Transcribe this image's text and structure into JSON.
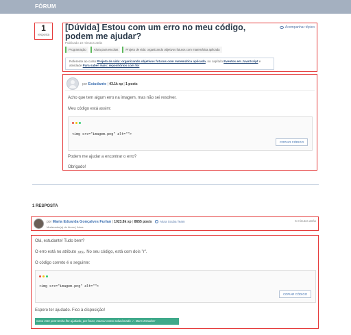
{
  "nav": {
    "title": "FÓRUM"
  },
  "topic": {
    "answer_count": "1",
    "answer_count_label": "resposta",
    "title": "[Dúvida] Estou com um erro no meu código, podem me ajudar?",
    "follow_label": "Acompanhar tópico",
    "posted": "Publicado 10 minutos atrás",
    "tags": [
      "Programação",
      "Alura para escolas",
      "Projeto de vida: organizando objetivos futuros com matemática aplicada"
    ],
    "course_ref": {
      "prefix": "Referente ao curso",
      "course": "Projeto de vida: organizando objetivos futuros com matemática aplicada",
      "chapter_prefix": ", no capítulo",
      "chapter": "Eventos em JavaScript",
      "activity_prefix": "e atividade",
      "activity": "Para saber mais: repositórios com for"
    }
  },
  "question": {
    "by": "por",
    "author": "Estudante",
    "xp": "43.1k xp",
    "posts": "1 posts",
    "p1": "Acho que tem algum erro na imagem, mas não sei resolver.",
    "p2": "Meu código está assim:",
    "code": "<img src=\"imagem.png\" alt=\"\">",
    "copy_label": "COPIAR CÓDIGO",
    "p3": "Podem me ajudar a encontrar o erro?",
    "p4": "Obrigado!"
  },
  "answers": {
    "count_label": "1 RESPOSTA",
    "author": {
      "by": "por",
      "name": "Maria Eduarda Gonçalves Furlan",
      "xp": "1023.8k xp",
      "posts": "8655 posts",
      "team": "Alura Scuba Team",
      "role": "Moderador(a) do fórum | Alura",
      "time": "5 minutos atrás"
    },
    "body": {
      "greeting": "Olá, estudante! Tudo bem?",
      "l1_prefix": "O erro está no atributo",
      "l1_code": "src",
      "l1_suffix": ". No seu código, está com dois \"r\".",
      "l2": "O código correto é o seguinte:",
      "code": "<img src=\"imagem.png\" alt=\"\">",
      "copy_label": "COPIAR CÓDIGO",
      "closing": "Espero ter ajudado. Fico à disposição!",
      "solved_note": "Caso este post tenha lhe ajudado, por favor, marcar como solucionado ✓. Bons Estudos!"
    }
  },
  "colors": {
    "highlight": "#e53b3b",
    "link": "#3c6fb0",
    "solved": "#3fa98a",
    "dot_red": "#e74c3c",
    "dot_yellow": "#f1c40f",
    "dot_green": "#2ecc71"
  }
}
